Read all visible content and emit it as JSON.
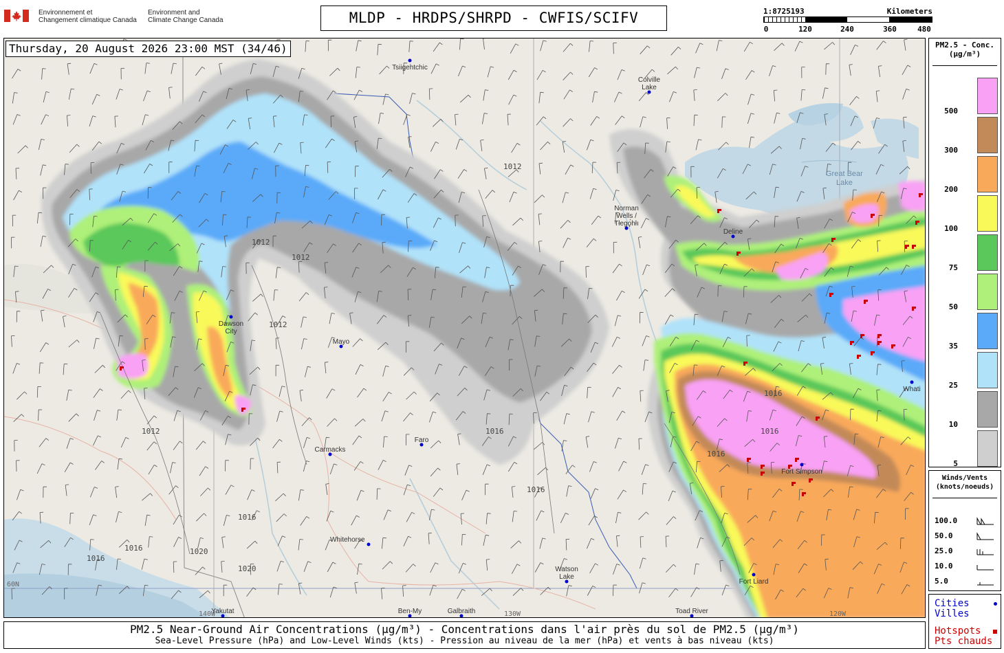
{
  "header": {
    "org_fr_line1": "Environnement et",
    "org_fr_line2": "Changement climatique Canada",
    "org_en_line1": "Environment and",
    "org_en_line2": "Climate Change Canada",
    "title": "MLDP - HRDPS/SHRPD - CWFIS/SCIFV"
  },
  "scale": {
    "ratio": "1:8725193",
    "unit": "Kilometers",
    "ticks": [
      "0",
      "120",
      "240",
      "360",
      "480"
    ]
  },
  "timestamp": "Thursday, 20 August 2026 23:00 MST (34/46)",
  "legend": {
    "conc_title_1": "PM2.5 - Conc.",
    "conc_title_2": "(µg/m³)",
    "bins": [
      {
        "label": "500",
        "color": "#f9a1f5"
      },
      {
        "label": "300",
        "color": "#c38a59"
      },
      {
        "label": "200",
        "color": "#f9a95a"
      },
      {
        "label": "100",
        "color": "#f9f95a"
      },
      {
        "label": "75",
        "color": "#5ac85a"
      },
      {
        "label": "50",
        "color": "#aef079"
      },
      {
        "label": "35",
        "color": "#5aaaf9"
      },
      {
        "label": "25",
        "color": "#b0e2f9"
      },
      {
        "label": "10",
        "color": "#a8a8a8"
      },
      {
        "label": "5",
        "color": "#cfcfcf"
      }
    ],
    "wind_title_1": "Winds/Vents",
    "wind_title_2": "(knots/noeuds)",
    "winds": [
      "100.0",
      "50.0",
      "25.0",
      "10.0",
      "5.0"
    ],
    "cities_1": "Cities",
    "cities_2": "Villes",
    "hotspots_1": "Hotspots",
    "hotspots_2": "Pts chauds",
    "city_color": "#0000cc",
    "hotspot_color": "#cc0000"
  },
  "map": {
    "cities": [
      {
        "name": "Tsiigehtchic",
        "label": "Tsiigehtchic"
      },
      {
        "name": "Colville Lake",
        "label": "Colville\nLake"
      },
      {
        "name": "Norman Wells",
        "label": "Norman\nWells /\nTłegǫ́hłı"
      },
      {
        "name": "Deline",
        "label": "Deline"
      },
      {
        "name": "Dawson City",
        "label": "Dawson\nCity"
      },
      {
        "name": "Mayo",
        "label": "Mayo"
      },
      {
        "name": "Carmacks",
        "label": "Carmacks"
      },
      {
        "name": "Faro",
        "label": "Faro"
      },
      {
        "name": "Whitehorse",
        "label": "Whitehorse"
      },
      {
        "name": "Watson Lake",
        "label": "Watson\nLake"
      },
      {
        "name": "Fort Simpson",
        "label": "Fort Simpson"
      },
      {
        "name": "Fort Liard",
        "label": "Fort Liard"
      },
      {
        "name": "Whati",
        "label": "Whati"
      },
      {
        "name": "Yakutat",
        "label": "Yakutat"
      },
      {
        "name": "Galbraith",
        "label": "Galbraith"
      },
      {
        "name": "Ben-My",
        "label": "Ben-My"
      },
      {
        "name": "Toad River",
        "label": "Toad River"
      }
    ],
    "water_labels": [
      "Great Bear\nLake"
    ],
    "isobar_labels": [
      "1012",
      "1016",
      "1020"
    ],
    "grid_labels": [
      "60N",
      "130W",
      "140W",
      "120W"
    ]
  },
  "footer": {
    "line1": "PM2.5 Near-Ground Air Concentrations (µg/m³) - Concentrations dans l'air près du sol de PM2.5 (µg/m³)",
    "line2": "Sea-Level Pressure (hPa) and Low-Level Winds (kts) - Pression au niveau de la mer (hPa) et vents à bas niveau (kts)"
  }
}
